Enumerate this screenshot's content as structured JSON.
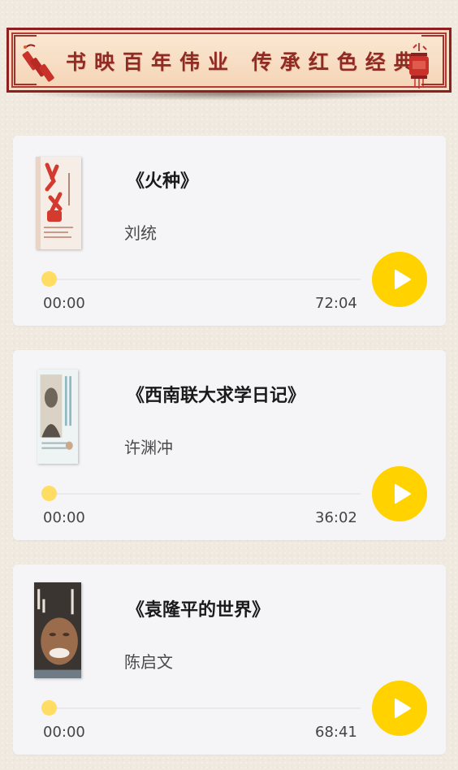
{
  "banner": {
    "title": "书映百年伟业 传承红色经典",
    "left_decor_icon": "firecracker-icon",
    "right_decor_icon": "lantern-icon"
  },
  "tracks": [
    {
      "title": "《火种》",
      "author": "刘统",
      "current_time": "00:00",
      "total_time": "72:04",
      "progress": 0,
      "cover_icon": "book-cover-image"
    },
    {
      "title": "《西南联大求学日记》",
      "author": "许渊冲",
      "current_time": "00:00",
      "total_time": "36:02",
      "progress": 0,
      "cover_icon": "book-cover-image"
    },
    {
      "title": "《袁隆平的世界》",
      "author": "陈启文",
      "current_time": "00:00",
      "total_time": "68:41",
      "progress": 0,
      "cover_icon": "book-cover-image"
    }
  ],
  "colors": {
    "accent": "#ffd200",
    "banner_red": "#8f2a24",
    "card_bg": "#f5f5f7",
    "page_bg": "#efe9df"
  }
}
